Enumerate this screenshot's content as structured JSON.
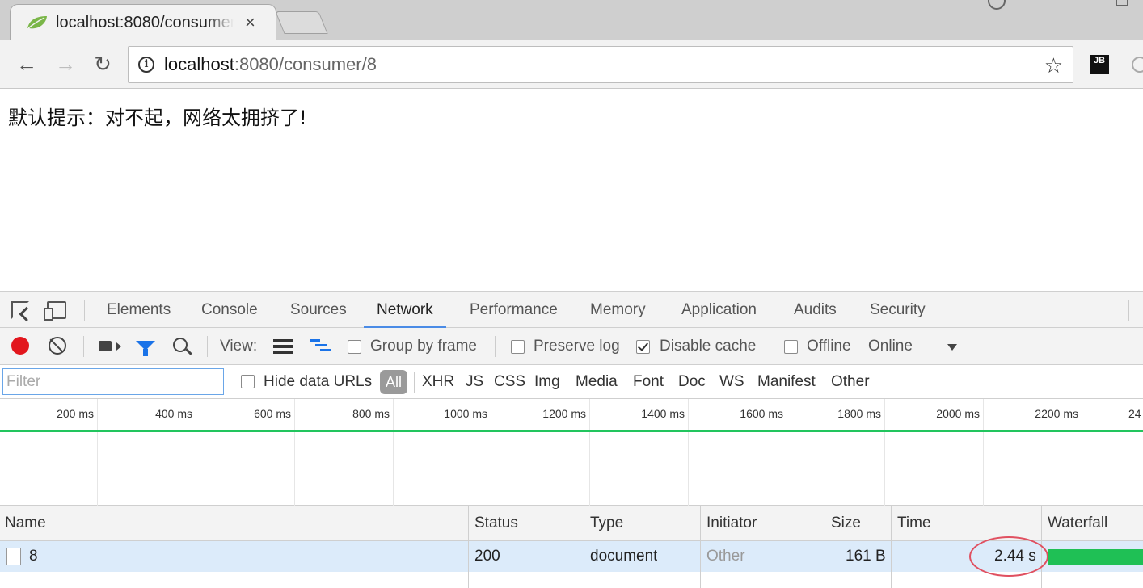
{
  "browser": {
    "tab_title": "localhost:8080/consumer/8",
    "tab_close": "×",
    "url_host": "localhost",
    "url_path": ":8080/consumer/8",
    "ext_label": "JB"
  },
  "page": {
    "message": "默认提示：对不起，网络太拥挤了!"
  },
  "devtools": {
    "tabs": [
      {
        "label": "Elements"
      },
      {
        "label": "Console"
      },
      {
        "label": "Sources"
      },
      {
        "label": "Network",
        "active": true
      },
      {
        "label": "Performance"
      },
      {
        "label": "Memory"
      },
      {
        "label": "Application"
      },
      {
        "label": "Audits"
      },
      {
        "label": "Security"
      }
    ],
    "toolbar": {
      "view_label": "View:",
      "group_by_frame": {
        "label": "Group by frame",
        "checked": false
      },
      "preserve_log": {
        "label": "Preserve log",
        "checked": false
      },
      "disable_cache": {
        "label": "Disable cache",
        "checked": true
      },
      "offline": {
        "label": "Offline",
        "checked": false
      },
      "throttling": "Online"
    },
    "filter_bar": {
      "placeholder": "Filter",
      "hide_data_urls": {
        "label": "Hide data URLs",
        "checked": false
      },
      "types": [
        "All",
        "XHR",
        "JS",
        "CSS",
        "Img",
        "Media",
        "Font",
        "Doc",
        "WS",
        "Manifest",
        "Other"
      ],
      "active_type": "All"
    },
    "overview_ticks": [
      "200 ms",
      "400 ms",
      "600 ms",
      "800 ms",
      "1000 ms",
      "1200 ms",
      "1400 ms",
      "1600 ms",
      "1800 ms",
      "2000 ms",
      "2200 ms",
      "24"
    ],
    "table": {
      "columns": [
        "Name",
        "Status",
        "Type",
        "Initiator",
        "Size",
        "Time",
        "Waterfall"
      ],
      "rows": [
        {
          "name": "8",
          "status": "200",
          "type": "document",
          "initiator": "Other",
          "size": "161 B",
          "time": "2.44 s"
        }
      ]
    },
    "colors": {
      "record": "#e2161d",
      "accent": "#1a73e8",
      "waterfall": "#1fc055",
      "selected_row": "#dcebfa",
      "annotation": "#e05060"
    }
  }
}
